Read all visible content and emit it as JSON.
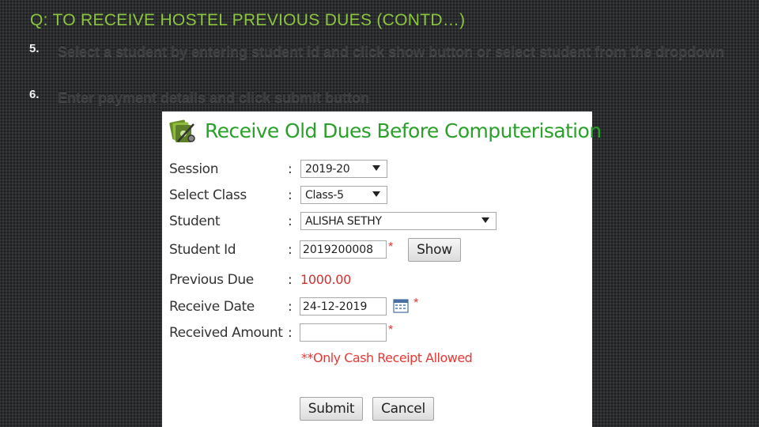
{
  "slide": {
    "title": "Q: TO RECEIVE HOSTEL PREVIOUS DUES (CONTD…)",
    "steps": [
      {
        "num": "5.",
        "text": "Select a student by entering student id and click  show button or select student from the dropdown"
      },
      {
        "num": "6.",
        "text": "Enter payment details and click submit button"
      }
    ]
  },
  "form": {
    "title": "Receive Old Dues Before Computerisation",
    "icon": "money-stack-icon",
    "fields": {
      "session": {
        "label": "Session",
        "colon": ":",
        "value": "2019-20"
      },
      "class": {
        "label": "Select Class",
        "colon": ":",
        "value": "Class-5"
      },
      "student": {
        "label": "Student",
        "colon": ":",
        "value": "ALISHA SETHY"
      },
      "student_id": {
        "label": "Student Id",
        "colon": ":",
        "value": "2019200008",
        "required": "*"
      },
      "previous_due": {
        "label": "Previous Due",
        "colon": ":",
        "value": "1000.00"
      },
      "receive_date": {
        "label": "Receive Date",
        "colon": ":",
        "value": "24-12-2019",
        "required": "*"
      },
      "received_amount": {
        "label": "Received Amount",
        "colon": ":",
        "value": "",
        "required": "*"
      }
    },
    "show_button": "Show",
    "note": "**Only Cash Receipt Allowed",
    "submit_button": "Submit",
    "cancel_button": "Cancel"
  },
  "colors": {
    "title": "#8cc63f",
    "form_title": "#2aa12a",
    "required": "#e53935",
    "due": "#d32f2f"
  }
}
